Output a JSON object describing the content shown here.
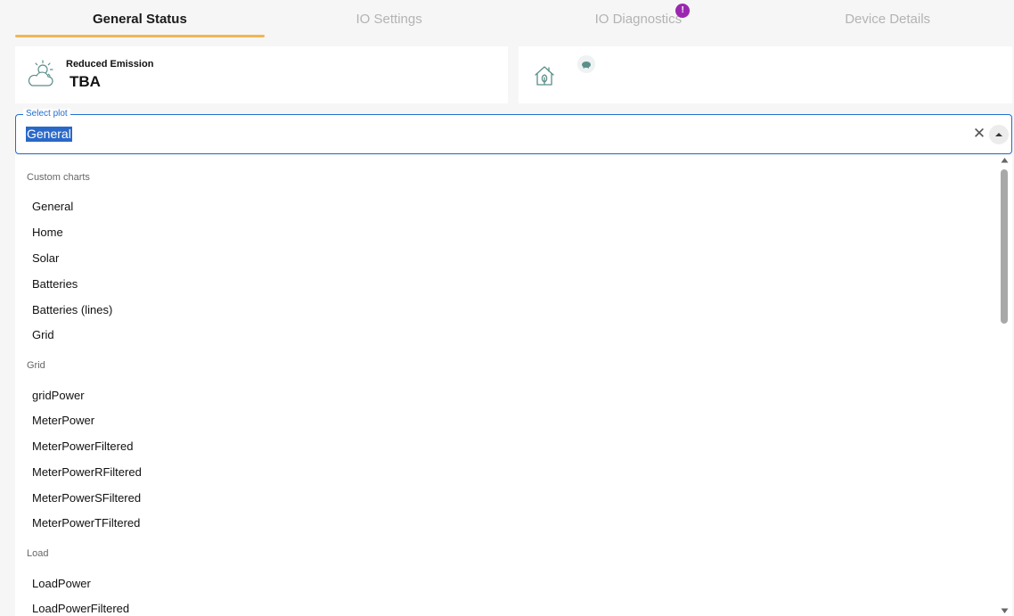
{
  "tabs": [
    {
      "label": "General Status",
      "active": true
    },
    {
      "label": "IO Settings",
      "active": false
    },
    {
      "label": "IO Diagnostics",
      "active": false,
      "badge": "!"
    },
    {
      "label": "Device Details",
      "active": false
    }
  ],
  "cards": {
    "emission": {
      "icon": "weather-sun-cloud-icon",
      "label": "Reduced Emission",
      "value": "TBA"
    },
    "home": {
      "icon": "home-leaf-icon",
      "secondary_icon": "piggy-bank-icon"
    }
  },
  "select": {
    "legend": "Select plot",
    "value": "General",
    "clear_icon": "close-icon",
    "popup_icon": "caret-up-icon"
  },
  "groups": [
    {
      "header": "Custom charts",
      "options": [
        "General",
        "Home",
        "Solar",
        "Batteries",
        "Batteries (lines)",
        "Grid"
      ]
    },
    {
      "header": "Grid",
      "options": [
        "gridPower",
        "MeterPower",
        "MeterPowerFiltered",
        "MeterPowerRFiltered",
        "MeterPowerSFiltered",
        "MeterPowerTFiltered"
      ]
    },
    {
      "header": "Load",
      "options": [
        "LoadPower",
        "LoadPowerFiltered"
      ]
    }
  ],
  "colors": {
    "accent": "#f2b552",
    "focus": "#1f6fd1",
    "badge": "#9b27b0",
    "icon": "#5a8f8a"
  }
}
